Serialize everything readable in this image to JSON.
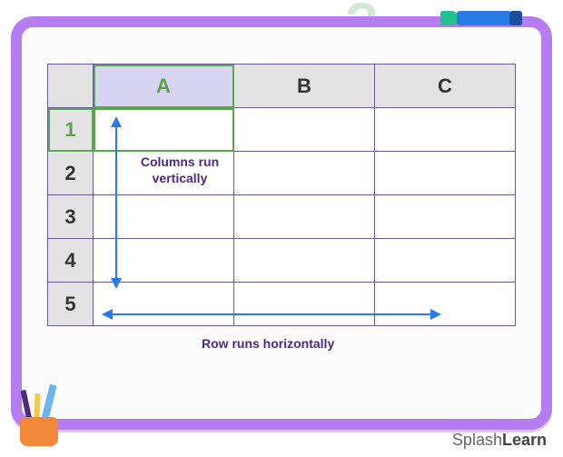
{
  "grid": {
    "columns": [
      "A",
      "B",
      "C"
    ],
    "rows": [
      "1",
      "2",
      "3",
      "4",
      "5"
    ]
  },
  "labels": {
    "column_note": "Columns run\nvertically",
    "row_note": "Row runs horizontally"
  },
  "brand": {
    "prefix": "Splash",
    "suffix": "Learn"
  }
}
